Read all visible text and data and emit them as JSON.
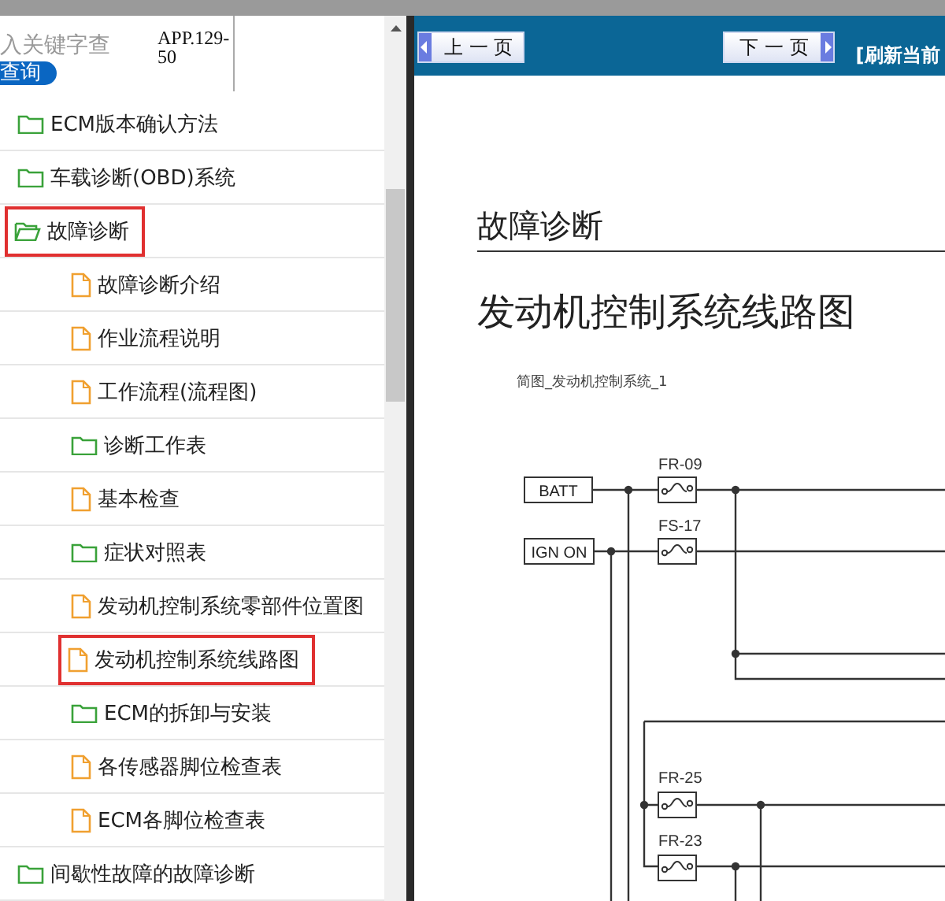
{
  "search": {
    "placeholder": "入关键字查",
    "button": "查询",
    "code": "APP.129-50"
  },
  "tree": [
    {
      "label": "ECM版本确认方法",
      "kind": "folder",
      "expanded": false,
      "highlighted": false
    },
    {
      "label": "车载诊断(OBD)系统",
      "kind": "folder",
      "expanded": false,
      "highlighted": false
    },
    {
      "label": "故障诊断",
      "kind": "folder",
      "expanded": true,
      "highlighted": true,
      "children": [
        {
          "label": "故障诊断介绍",
          "kind": "doc",
          "highlighted": false
        },
        {
          "label": "作业流程说明",
          "kind": "doc",
          "highlighted": false
        },
        {
          "label": "工作流程(流程图)",
          "kind": "doc",
          "highlighted": false
        },
        {
          "label": "诊断工作表",
          "kind": "folder",
          "expanded": false,
          "highlighted": false
        },
        {
          "label": "基本检查",
          "kind": "doc",
          "highlighted": false
        },
        {
          "label": "症状对照表",
          "kind": "folder",
          "expanded": false,
          "highlighted": false
        },
        {
          "label": "发动机控制系统零部件位置图",
          "kind": "doc",
          "highlighted": false
        },
        {
          "label": "发动机控制系统线路图",
          "kind": "doc",
          "highlighted": true
        },
        {
          "label": "ECM的拆卸与安装",
          "kind": "folder",
          "expanded": false,
          "highlighted": false
        },
        {
          "label": "各传感器脚位检查表",
          "kind": "doc",
          "highlighted": false
        },
        {
          "label": "ECM各脚位检查表",
          "kind": "doc",
          "highlighted": false
        }
      ]
    },
    {
      "label": "间歇性故障的故障诊断",
      "kind": "folder",
      "expanded": false,
      "highlighted": false
    }
  ],
  "toolbar": {
    "buttons": [
      {
        "label": "上一页",
        "kind": "prev"
      },
      {
        "label": "下一页",
        "kind": "next"
      }
    ],
    "refresh": "[刷新当前"
  },
  "document": {
    "section": "故障诊断",
    "title": "发动机控制系统线路图",
    "caption": "简图_发动机控制系统_1",
    "diagram": {
      "inputs": [
        "BATT",
        "IGN ON"
      ],
      "fuses": [
        "FR-09",
        "FS-17",
        "FR-25",
        "FR-23"
      ]
    }
  }
}
